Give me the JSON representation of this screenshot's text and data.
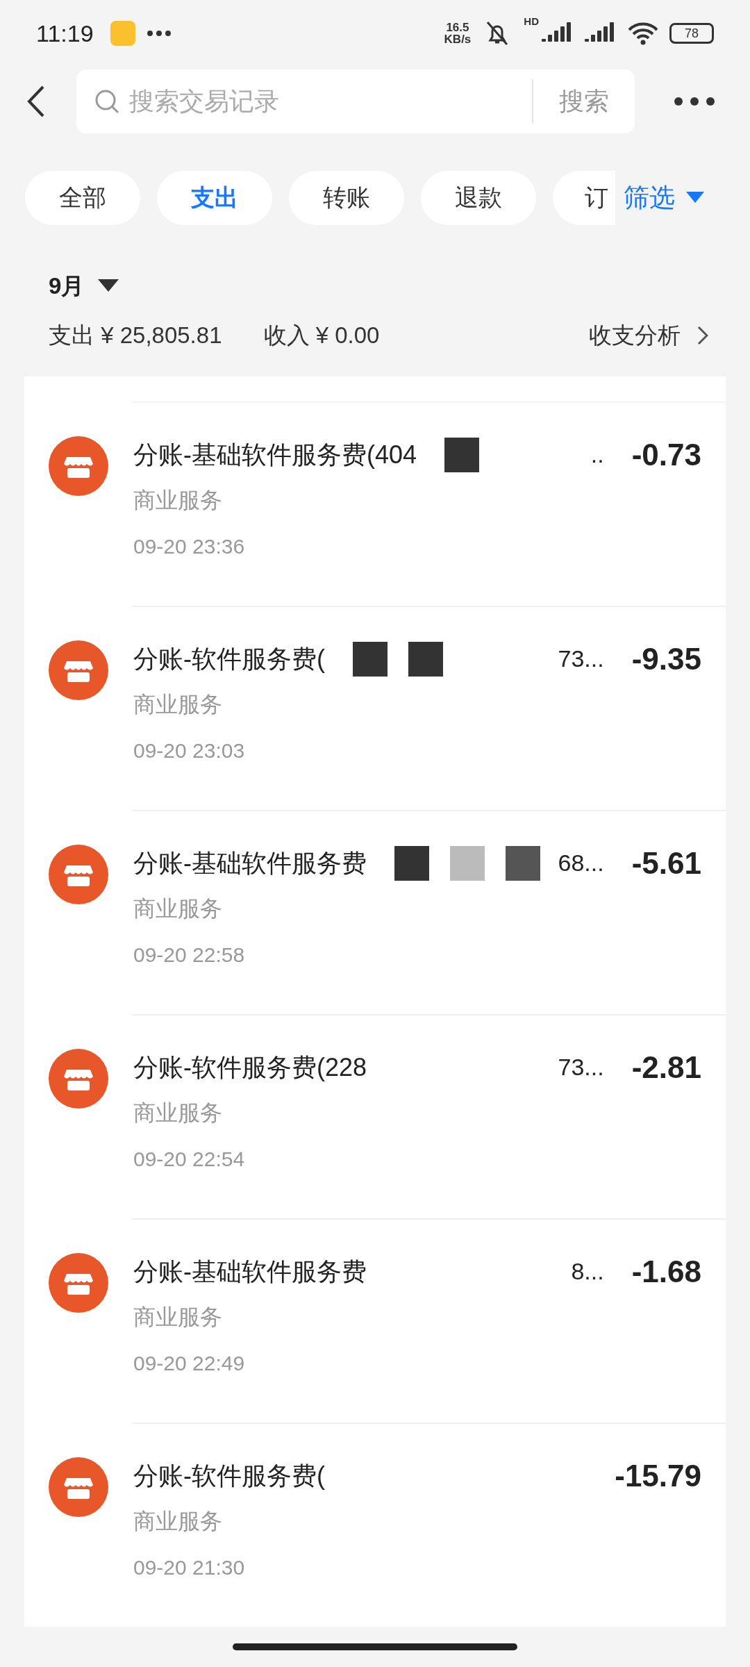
{
  "status_bar": {
    "time": "11:19",
    "net_speed": "16.5",
    "net_unit": "KB/s",
    "hd": "HD",
    "battery": "78"
  },
  "search": {
    "placeholder": "搜索交易记录",
    "button": "搜索"
  },
  "filters": [
    {
      "label": "全部",
      "selected": false
    },
    {
      "label": "支出",
      "selected": true
    },
    {
      "label": "转账",
      "selected": false
    },
    {
      "label": "退款",
      "selected": false
    },
    {
      "label": "订",
      "selected": false
    }
  ],
  "filter_menu": "筛选",
  "month": "9月",
  "summary": {
    "expense": "支出 ¥ 25,805.81",
    "income": "收入 ¥ 0.00",
    "analysis": "收支分析"
  },
  "transactions": [
    {
      "title": "分账-基础软件服务费(404",
      "tail": "..",
      "masks": [
        {
          "color": "#333333"
        }
      ],
      "category": "商业服务",
      "time": "09-20 23:36",
      "amount": "-0.73"
    },
    {
      "title": "分账-软件服务费(",
      "tail": "73...",
      "masks": [
        {
          "color": "#333333"
        },
        {
          "color": "#333333"
        }
      ],
      "category": "商业服务",
      "time": "09-20 23:03",
      "amount": "-9.35"
    },
    {
      "title": "分账-基础软件服务费",
      "tail": "68...",
      "masks": [
        {
          "color": "#333333"
        },
        {
          "color": "#bbbbbb"
        },
        {
          "color": "#555555"
        }
      ],
      "category": "商业服务",
      "time": "09-20 22:58",
      "amount": "-5.61"
    },
    {
      "title": "分账-软件服务费(228",
      "tail": "73...",
      "category": "商业服务",
      "time": "09-20 22:54",
      "amount": "-2.81"
    },
    {
      "title": "分账-基础软件服务费",
      "tail": "8...",
      "category": "商业服务",
      "time": "09-20 22:49",
      "amount": "-1.68"
    },
    {
      "title": "分账-软件服务费(",
      "category": "商业服务",
      "time": "09-20 21:30",
      "amount": "-15.79"
    }
  ]
}
